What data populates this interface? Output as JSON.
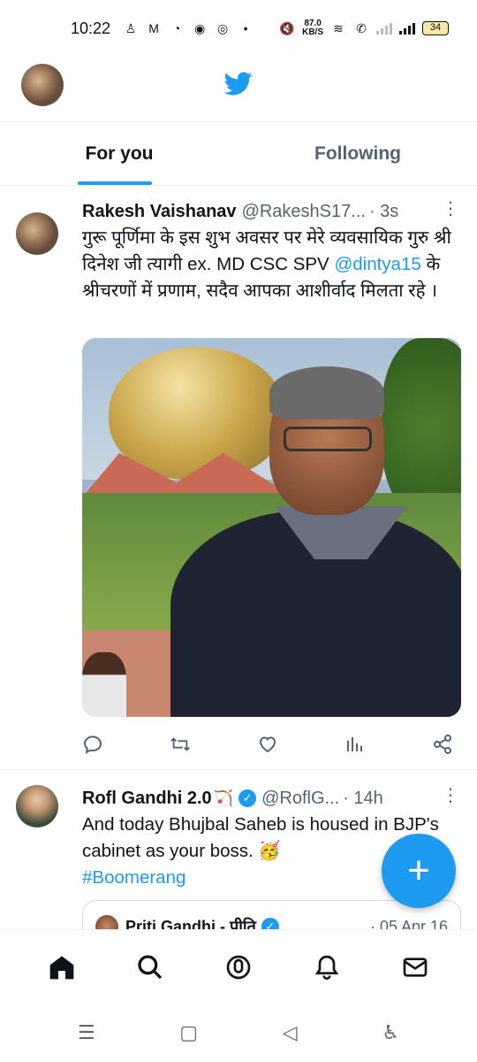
{
  "status_bar": {
    "time": "10:22",
    "net_speed_value": "87.0",
    "net_speed_unit": "KB/S",
    "battery": "34"
  },
  "header": {
    "logo": "twitter-bird-icon"
  },
  "tabs": [
    {
      "label": "For you",
      "active": true
    },
    {
      "label": "Following",
      "active": false
    }
  ],
  "tweets": [
    {
      "name": "Rakesh Vaishanav",
      "handle": "@RakeshS17...",
      "time": "· 3s",
      "text_part1": "गुरू पूर्णिमा के इस शुभ अवसर पर मेरे व्यवसायिक गुरु श्री दिनेश जी त्यागी ex. MD CSC SPV ",
      "mention": "@dintya15",
      "text_part2": " के श्रीचरणों में प्रणाम, सदैव आपका आशीर्वाद मिलता रहे ।"
    },
    {
      "name": "Rofl Gandhi 2.0",
      "name_emoji": "🏹",
      "handle": "@RoflG...",
      "time": "· 14h",
      "text_part1": "And today Bhujbal Saheb is housed in BJP's cabinet as your boss. 🥳",
      "hashtag": "#Boomerang",
      "quote": {
        "name": "Priti Gandhi - प्रीति",
        "time": "· 05 Apr 16"
      }
    }
  ],
  "colors": {
    "accent": "#1d9bf0",
    "text": "#0f1419",
    "muted": "#536471"
  }
}
